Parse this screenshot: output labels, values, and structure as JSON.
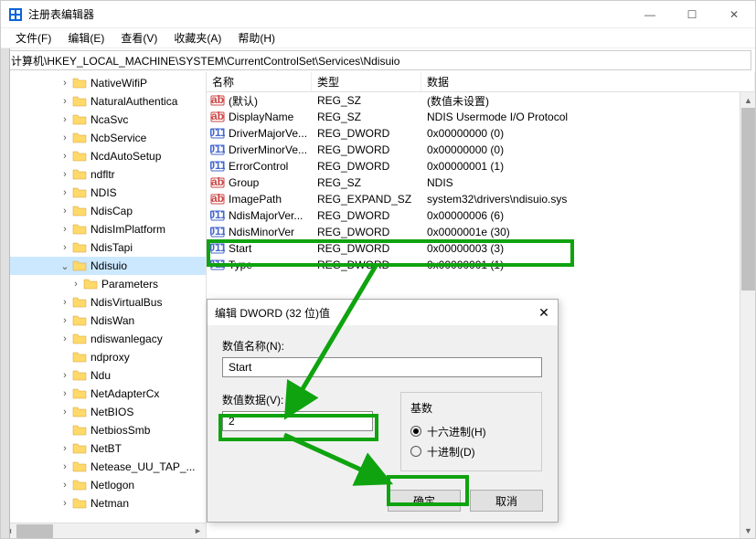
{
  "window": {
    "title": "注册表编辑器",
    "minimize": "—",
    "maximize": "☐",
    "close": "✕"
  },
  "menu": {
    "file": "文件(F)",
    "edit": "编辑(E)",
    "view": "查看(V)",
    "favorites": "收藏夹(A)",
    "help": "帮助(H)"
  },
  "address": "计算机\\HKEY_LOCAL_MACHINE\\SYSTEM\\CurrentControlSet\\Services\\Ndisuio",
  "tree": [
    {
      "label": "NativeWifiP",
      "depth": 5,
      "expander": ">"
    },
    {
      "label": "NaturalAuthentica",
      "depth": 5,
      "expander": ">"
    },
    {
      "label": "NcaSvc",
      "depth": 5,
      "expander": ">"
    },
    {
      "label": "NcbService",
      "depth": 5,
      "expander": ">"
    },
    {
      "label": "NcdAutoSetup",
      "depth": 5,
      "expander": ">"
    },
    {
      "label": "ndfltr",
      "depth": 5,
      "expander": ">"
    },
    {
      "label": "NDIS",
      "depth": 5,
      "expander": ">"
    },
    {
      "label": "NdisCap",
      "depth": 5,
      "expander": ">"
    },
    {
      "label": "NdisImPlatform",
      "depth": 5,
      "expander": ">"
    },
    {
      "label": "NdisTapi",
      "depth": 5,
      "expander": ">"
    },
    {
      "label": "Ndisuio",
      "depth": 5,
      "expander": "v",
      "selected": true
    },
    {
      "label": "Parameters",
      "depth": 6,
      "expander": ">"
    },
    {
      "label": "NdisVirtualBus",
      "depth": 5,
      "expander": ">"
    },
    {
      "label": "NdisWan",
      "depth": 5,
      "expander": ">"
    },
    {
      "label": "ndiswanlegacy",
      "depth": 5,
      "expander": ">"
    },
    {
      "label": "ndproxy",
      "depth": 5,
      "expander": ""
    },
    {
      "label": "Ndu",
      "depth": 5,
      "expander": ">"
    },
    {
      "label": "NetAdapterCx",
      "depth": 5,
      "expander": ">"
    },
    {
      "label": "NetBIOS",
      "depth": 5,
      "expander": ">"
    },
    {
      "label": "NetbiosSmb",
      "depth": 5,
      "expander": ""
    },
    {
      "label": "NetBT",
      "depth": 5,
      "expander": ">"
    },
    {
      "label": "Netease_UU_TAP_...",
      "depth": 5,
      "expander": ">"
    },
    {
      "label": "Netlogon",
      "depth": 5,
      "expander": ">"
    },
    {
      "label": "Netman",
      "depth": 5,
      "expander": ">"
    }
  ],
  "list": {
    "headers": {
      "name": "名称",
      "type": "类型",
      "data": "数据"
    },
    "rows": [
      {
        "icon": "str",
        "name": "(默认)",
        "type": "REG_SZ",
        "data": "(数值未设置)"
      },
      {
        "icon": "str",
        "name": "DisplayName",
        "type": "REG_SZ",
        "data": "NDIS Usermode I/O Protocol"
      },
      {
        "icon": "bin",
        "name": "DriverMajorVe...",
        "type": "REG_DWORD",
        "data": "0x00000000 (0)"
      },
      {
        "icon": "bin",
        "name": "DriverMinorVe...",
        "type": "REG_DWORD",
        "data": "0x00000000 (0)"
      },
      {
        "icon": "bin",
        "name": "ErrorControl",
        "type": "REG_DWORD",
        "data": "0x00000001 (1)"
      },
      {
        "icon": "str",
        "name": "Group",
        "type": "REG_SZ",
        "data": "NDIS"
      },
      {
        "icon": "str",
        "name": "ImagePath",
        "type": "REG_EXPAND_SZ",
        "data": "system32\\drivers\\ndisuio.sys"
      },
      {
        "icon": "bin",
        "name": "NdisMajorVer...",
        "type": "REG_DWORD",
        "data": "0x00000006 (6)"
      },
      {
        "icon": "bin",
        "name": "NdisMinorVer",
        "type": "REG_DWORD",
        "data": "0x0000001e (30)"
      },
      {
        "icon": "bin",
        "name": "Start",
        "type": "REG_DWORD",
        "data": "0x00000003 (3)"
      },
      {
        "icon": "bin",
        "name": "Type",
        "type": "REG_DWORD",
        "data": "0x00000001 (1)"
      }
    ]
  },
  "dialog": {
    "title": "编辑 DWORD (32 位)值",
    "label_name": "数值名称(N):",
    "value_name": "Start",
    "label_data": "数值数据(V):",
    "value_data": "2",
    "base_label": "基数",
    "radio_hex": "十六进制(H)",
    "radio_dec": "十进制(D)",
    "ok": "确定",
    "cancel": "取消",
    "close": "✕"
  }
}
